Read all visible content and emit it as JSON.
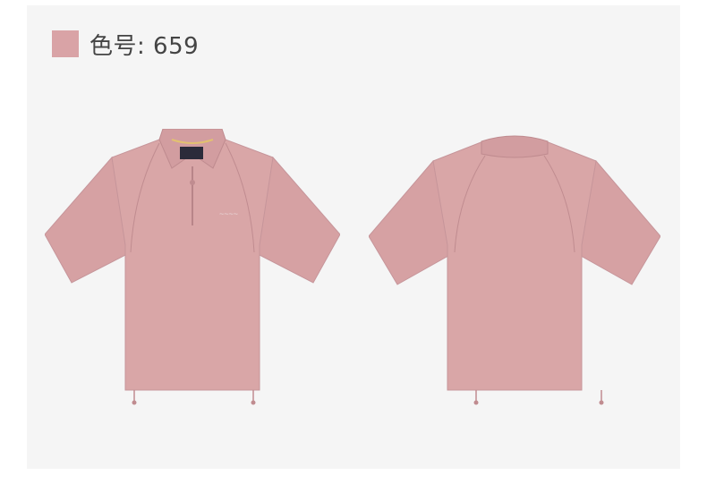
{
  "swatch": {
    "color": "#d9a3a6",
    "label": "色号: 659"
  },
  "views": [
    {
      "name": "front",
      "shirt_color": "#d9a6a7",
      "accent_color": "#c89296"
    },
    {
      "name": "back",
      "shirt_color": "#d9a6a7",
      "accent_color": "#c89296"
    }
  ]
}
